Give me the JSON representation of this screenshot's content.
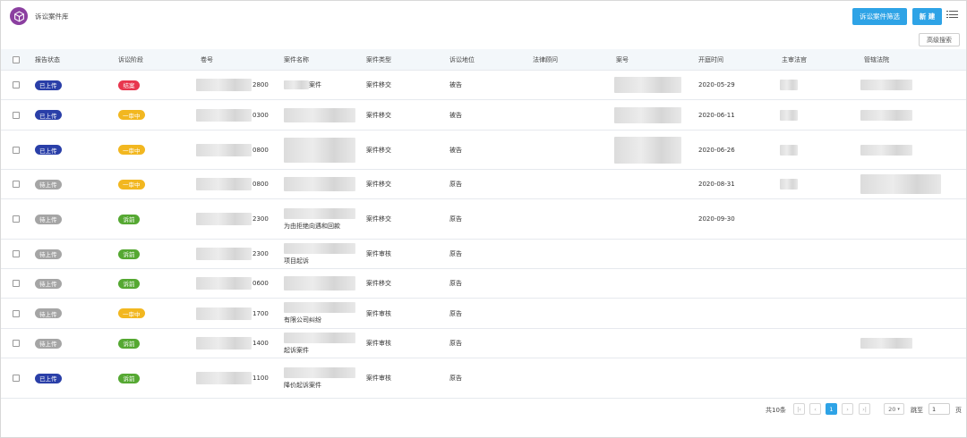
{
  "header": {
    "title": "诉讼案件库",
    "filter_button": "诉讼案件筛选",
    "new_button": "新 建",
    "advanced_search": "高级搜索"
  },
  "columns": [
    "报告状态",
    "诉讼阶段",
    "卷号",
    "案件名称",
    "案件类型",
    "诉讼地位",
    "法律顾问",
    "案号",
    "开庭时间",
    "主审法官",
    "管辖法院"
  ],
  "rows": [
    {
      "status": "已上传",
      "status_color": "blue",
      "stage": "结案",
      "stage_color": "red",
      "file_no": "2800",
      "name": [
        "案件"
      ],
      "type": "案件移交",
      "position": "被告",
      "hearing": "2020-05-29"
    },
    {
      "status": "已上传",
      "status_color": "blue",
      "stage": "一审中",
      "stage_color": "yellow",
      "file_no": "0300",
      "name": [],
      "type": "案件移交",
      "position": "被告",
      "hearing": "2020-06-11"
    },
    {
      "status": "已上传",
      "status_color": "blue",
      "stage": "一审中",
      "stage_color": "yellow",
      "file_no": "0800",
      "name": [],
      "type": "案件移交",
      "position": "被告",
      "hearing": "2020-06-26"
    },
    {
      "status": "待上传",
      "status_color": "gray",
      "stage": "一审中",
      "stage_color": "yellow",
      "file_no": "0800",
      "name": [],
      "type": "案件移交",
      "position": "原告",
      "hearing": "2020-08-31"
    },
    {
      "status": "待上传",
      "status_color": "gray",
      "stage": "诉前",
      "stage_color": "green",
      "file_no": "2300",
      "name": [
        "为由拒绝向遇和回款"
      ],
      "type": "案件移交",
      "position": "原告",
      "hearing": "2020-09-30"
    },
    {
      "status": "待上传",
      "status_color": "gray",
      "stage": "诉前",
      "stage_color": "green",
      "file_no": "2300",
      "name": [
        "项目起诉"
      ],
      "type": "案件审核",
      "position": "原告",
      "hearing": ""
    },
    {
      "status": "待上传",
      "status_color": "gray",
      "stage": "诉前",
      "stage_color": "green",
      "file_no": "0600",
      "name": [],
      "type": "案件移交",
      "position": "原告",
      "hearing": ""
    },
    {
      "status": "待上传",
      "status_color": "gray",
      "stage": "一审中",
      "stage_color": "yellow",
      "file_no": "1700",
      "name": [
        "有限公司纠纷"
      ],
      "type": "案件审核",
      "position": "原告",
      "hearing": ""
    },
    {
      "status": "待上传",
      "status_color": "gray",
      "stage": "诉前",
      "stage_color": "green",
      "file_no": "1400",
      "name": [
        "起诉案件"
      ],
      "type": "案件审核",
      "position": "原告",
      "hearing": ""
    },
    {
      "status": "已上传",
      "status_color": "blue",
      "stage": "诉前",
      "stage_color": "green",
      "file_no": "1100",
      "name": [
        "降价起诉案件"
      ],
      "type": "案件审核",
      "position": "原告",
      "hearing": ""
    }
  ],
  "pagination": {
    "total": "共10条",
    "current_page": "1",
    "page_size": "20",
    "goto_label": "跳至",
    "goto_value": "1",
    "page_unit": "页"
  },
  "colors": {
    "primary": "#2ea3e6",
    "uploaded": "#2a3fa8",
    "pending": "#a5a5a5",
    "closed": "#e8364e",
    "first_instance": "#f2b720",
    "pre_litigation": "#55a832",
    "logo": "#8b3fa0"
  }
}
